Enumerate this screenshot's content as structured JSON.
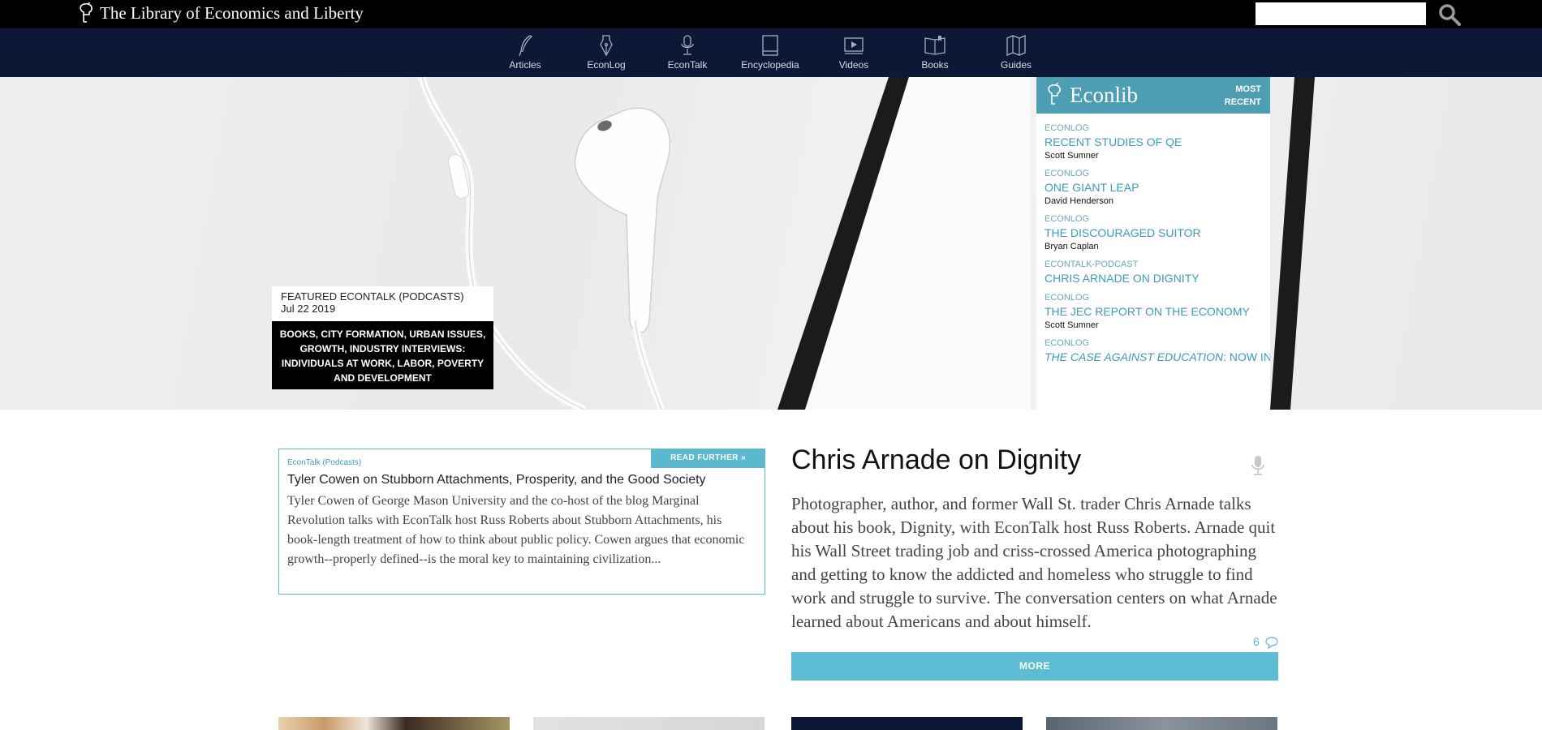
{
  "top_bar": {
    "site_title": "The Library of Economics and Liberty",
    "search_placeholder": "",
    "search_icon": "search-icon"
  },
  "nav": {
    "items": [
      {
        "label": "Articles",
        "icon": "quill-icon"
      },
      {
        "label": "EconLog",
        "icon": "pen-nib-icon"
      },
      {
        "label": "EconTalk",
        "icon": "microphone-icon"
      },
      {
        "label": "Encyclopedia",
        "icon": "book-icon"
      },
      {
        "label": "Videos",
        "icon": "video-icon"
      },
      {
        "label": "Books",
        "icon": "open-book-icon"
      },
      {
        "label": "Guides",
        "icon": "map-icon"
      }
    ]
  },
  "hero": {
    "featured_label": "FEATURED ECONTALK (PODCASTS)",
    "featured_date": "Jul 22 2019",
    "tags": "BOOKS, CITY FORMATION, URBAN ISSUES, GROWTH, INDUSTRY INTERVIEWS: INDIVIDUALS AT WORK, LABOR, POVERTY AND DEVELOPMENT"
  },
  "recent": {
    "brand": "Econlib",
    "heading": "MOST RECENT",
    "items": [
      {
        "category": "ECONLOG",
        "title": "RECENT STUDIES OF QE",
        "author": "Scott Sumner"
      },
      {
        "category": "ECONLOG",
        "title": "ONE GIANT LEAP",
        "author": "David Henderson"
      },
      {
        "category": "ECONLOG",
        "title": "THE DISCOURAGED SUITOR",
        "author": "Bryan Caplan"
      },
      {
        "category": "ECONTALK-PODCAST",
        "title": "CHRIS ARNADE ON DIGNITY",
        "author": ""
      },
      {
        "category": "ECONLOG",
        "title": "THE JEC REPORT ON THE ECONOMY",
        "author": "Scott Sumner"
      },
      {
        "category": "ECONLOG",
        "title_italic": "THE CASE AGAINST EDUCATION",
        "title": ": NOW IN",
        "author": ""
      }
    ]
  },
  "podcast_card": {
    "read_further": "READ FURTHER »",
    "category": "EconTalk (Podcasts)",
    "title": "Tyler Cowen on Stubborn Attachments, Prosperity, and the Good Society",
    "summary": "Tyler Cowen of George Mason University and the co-host of the blog Marginal Revolution talks with EconTalk host Russ Roberts about Stubborn Attachments, his book-length treatment of how to think about public policy. Cowen argues that economic growth--properly defined--is the moral key to maintaining civilization..."
  },
  "article": {
    "title": "Chris Arnade on Dignity",
    "icon": "microphone-icon",
    "summary": "Photographer, author, and former Wall St. trader Chris Arnade talks about his book, Dignity, with EconTalk host Russ Roberts. Arnade quit his Wall Street trading job and criss-crossed America photographing and getting to know the addicted and homeless who struggle to find work and struggle to survive. The conversation centers on what Arnade learned about Americans and about himself.",
    "comment_count": "6",
    "more_label": "MORE"
  },
  "colors": {
    "top_bar": "#000000",
    "nav_bar": "#0d1836",
    "accent": "#5ab8cf",
    "econlib_header": "#4d9db3",
    "link": "#3c9bbd"
  }
}
